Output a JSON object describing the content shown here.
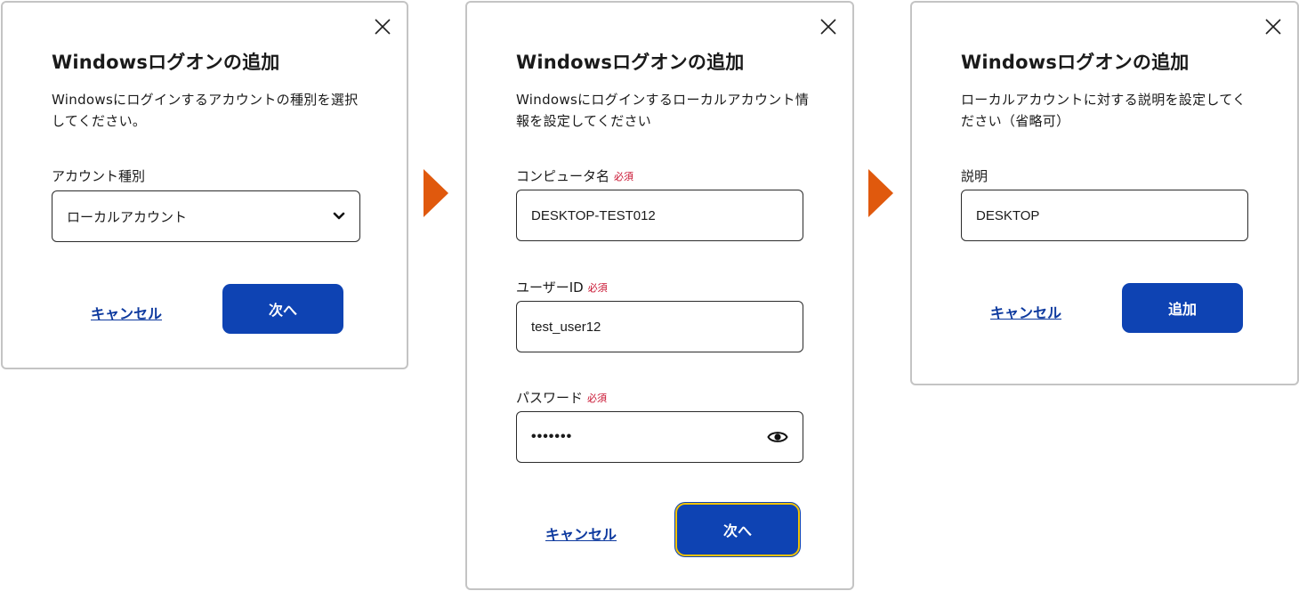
{
  "colors": {
    "primary": "#0e43b3",
    "link": "#0e3a9f",
    "required": "#c8102e",
    "arrow": "#e0590d",
    "focus_ring": "#f3c300",
    "border": "#c4c4c4"
  },
  "dialog1": {
    "title": "Windowsログオンの追加",
    "description": "Windowsにログインするアカウントの種別を選択してください。",
    "account_type_label": "アカウント種別",
    "account_type_value": "ローカルアカウント",
    "cancel_label": "キャンセル",
    "next_label": "次へ"
  },
  "dialog2": {
    "title": "Windowsログオンの追加",
    "description": "Windowsにログインするローカルアカウント情報を設定してください",
    "computer_name_label": "コンピュータ名",
    "computer_name_value": "DESKTOP-TEST012",
    "user_id_label": "ユーザーID",
    "user_id_value": "test_user12",
    "password_label": "パスワード",
    "password_value": "•••••••",
    "required_label": "必須",
    "cancel_label": "キャンセル",
    "next_label": "次へ"
  },
  "dialog3": {
    "title": "Windowsログオンの追加",
    "description": "ローカルアカウントに対する説明を設定してください（省略可）",
    "description_field_label": "説明",
    "description_field_value": "DESKTOP",
    "cancel_label": "キャンセル",
    "add_label": "追加"
  },
  "icons": {
    "close": "close-icon",
    "dropdown": "chevron-down-icon",
    "show_password": "eye-icon",
    "step_arrow": "arrow-right-icon"
  }
}
